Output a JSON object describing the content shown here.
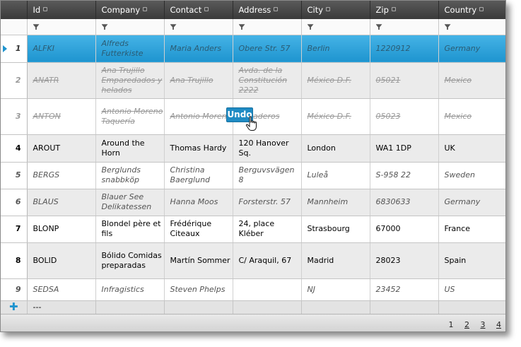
{
  "columns": [
    {
      "label": "Id"
    },
    {
      "label": "Company"
    },
    {
      "label": "Contact"
    },
    {
      "label": "Address"
    },
    {
      "label": "City"
    },
    {
      "label": "Zip"
    },
    {
      "label": "Country"
    }
  ],
  "rows": [
    {
      "num": "1",
      "state": "selected",
      "id": "ALFKI",
      "company": "Alfreds Futterkiste",
      "contact": "Maria Anders",
      "address": "Obere Str. 57",
      "city": "Berlin",
      "zip": "1220912",
      "country": "Germany"
    },
    {
      "num": "2",
      "state": "deleted",
      "id": "ANATR",
      "company": "Ana Trujillo Emparedados y helados",
      "contact": "Ana Trujillo",
      "address": "Avda. de la Constitución 2222",
      "city": "México D.F.",
      "zip": "05021",
      "country": "Mexico"
    },
    {
      "num": "3",
      "state": "deleted",
      "id": "ANTON",
      "company": "Antonio Moreno Taquería",
      "contact": "Antonio Moreno",
      "address": "Mataderos",
      "city": "México D.F.",
      "zip": "05023",
      "country": "Mexico"
    },
    {
      "num": "4",
      "state": "normal",
      "id": "AROUT",
      "company": "Around the Horn",
      "contact": "Thomas Hardy",
      "address": "120 Hanover Sq.",
      "city": "London",
      "zip": "WA1 1DP",
      "country": "UK"
    },
    {
      "num": "5",
      "state": "italic",
      "id": "BERGS",
      "company": "Berglunds snabbköp",
      "contact": "Christina Baerglund",
      "address": "Berguvsvägen 8",
      "city": "Luleå",
      "zip": "S-958 22",
      "country": "Sweden"
    },
    {
      "num": "6",
      "state": "italic",
      "id": "BLAUS",
      "company": "Blauer See Delikatessen",
      "contact": "Hanna Moos",
      "address": "Forsterstr. 57",
      "city": "Mannheim",
      "zip": "6830633",
      "country": "Germany"
    },
    {
      "num": "7",
      "state": "normal",
      "id": "BLONP",
      "company": "Blondel père et fils",
      "contact": "Frédérique Citeaux",
      "address": "24, place Kléber",
      "city": "Strasbourg",
      "zip": "67000",
      "country": "France"
    },
    {
      "num": "8",
      "state": "normal",
      "id": "BOLID",
      "company": "Bólido Comidas preparadas",
      "contact": "Martín Sommer",
      "address": "C/ Araquil, 67",
      "city": "Madrid",
      "zip": "28023",
      "country": "Spain"
    },
    {
      "num": "9",
      "state": "italic",
      "id": "SEDSA",
      "company": "Infragistics",
      "contact": "Steven Phelps",
      "address": "",
      "city": "NJ",
      "zip": "23452",
      "country": "US"
    }
  ],
  "add_row": {
    "id_placeholder": "---"
  },
  "undo_label": "Undo",
  "pager": {
    "pages": [
      "1",
      "2",
      "3",
      "4"
    ],
    "current": "1"
  },
  "colors": {
    "selected": "#1e94cf",
    "header": "#3a3a3a",
    "deleted_text": "#9a9a9a"
  }
}
